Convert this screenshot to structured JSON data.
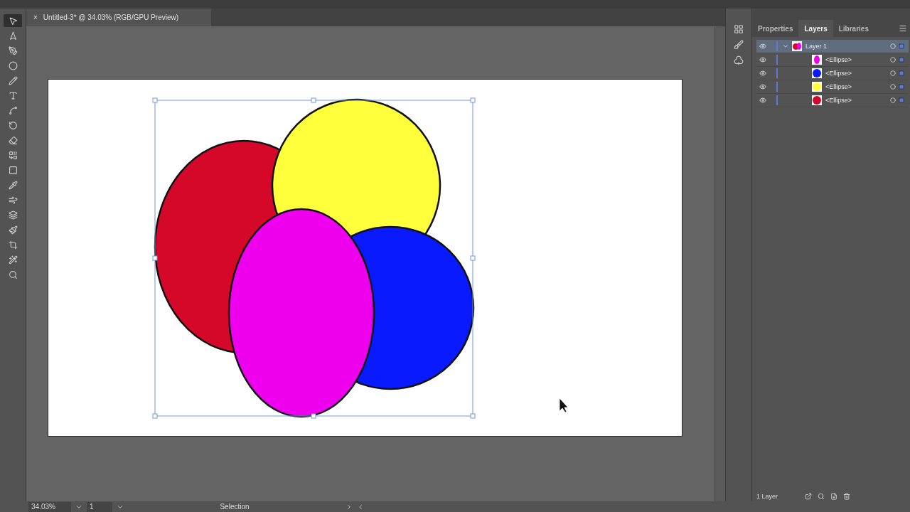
{
  "document_tab": {
    "title": "Untitled-3* @ 34.03% (RGB/GPU Preview)",
    "close": "×"
  },
  "tools": [
    {
      "kind": "selection",
      "selected": true
    },
    {
      "kind": "direct",
      "selected": false
    },
    {
      "kind": "pen",
      "selected": false
    },
    {
      "kind": "ellipse",
      "selected": false
    },
    {
      "kind": "pencil",
      "selected": false
    },
    {
      "kind": "type",
      "selected": false
    },
    {
      "kind": "arc",
      "selected": false
    },
    {
      "kind": "rotate",
      "selected": false
    },
    {
      "kind": "eraser",
      "selected": false
    },
    {
      "kind": "builder",
      "selected": false
    },
    {
      "kind": "gradient",
      "selected": false
    },
    {
      "kind": "eyedropper",
      "selected": false
    },
    {
      "kind": "warp",
      "selected": false
    },
    {
      "kind": "blend",
      "selected": false
    },
    {
      "kind": "brush",
      "selected": false
    },
    {
      "kind": "artboard",
      "selected": false
    },
    {
      "kind": "wand",
      "selected": false
    },
    {
      "kind": "zoom",
      "selected": false
    }
  ],
  "panel_tabs": [
    {
      "label": "Properties",
      "selected": false
    },
    {
      "label": "Layers",
      "selected": true
    },
    {
      "label": "Libraries",
      "selected": false
    }
  ],
  "layers": [
    {
      "name": "Layer 1",
      "expanded": true,
      "selected": true,
      "children": [
        {
          "name": "<Ellipse>",
          "color": "#ee00ee",
          "selected": false
        },
        {
          "name": "<Ellipse>",
          "color": "#0a1aff",
          "selected": false
        },
        {
          "name": "<Ellipse>",
          "color": "#ffff3c",
          "selected": false
        },
        {
          "name": "<Ellipse>",
          "color": "#d6082a",
          "selected": false
        }
      ]
    }
  ],
  "layers_footer": {
    "count": "1 Layer"
  },
  "status_bar": {
    "zoom": "34.03%",
    "page": "1",
    "tool": "Selection"
  }
}
